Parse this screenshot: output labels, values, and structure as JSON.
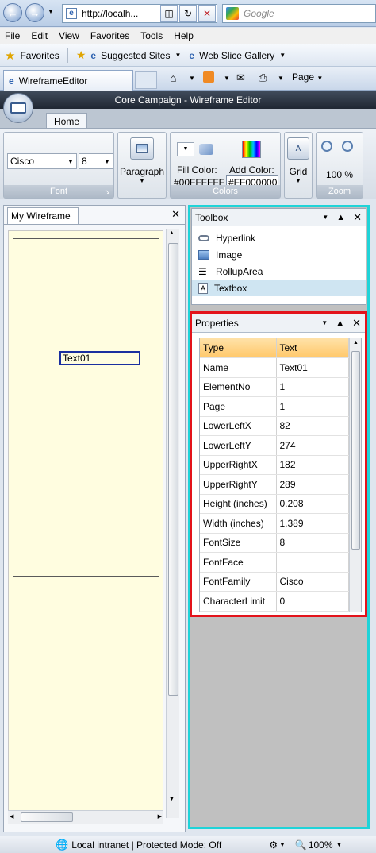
{
  "browser": {
    "url": "http://localh...",
    "search_placeholder": "Google",
    "menu": [
      "File",
      "Edit",
      "View",
      "Favorites",
      "Tools",
      "Help"
    ],
    "favorites_label": "Favorites",
    "suggested_sites": "Suggested Sites",
    "web_slice_gallery": "Web Slice Gallery",
    "tab_title": "WireframeEditor",
    "page_label": "Page"
  },
  "app": {
    "title": "Core Campaign - Wireframe Editor",
    "ribbon_tab": "Home",
    "font": {
      "family": "Cisco",
      "size": "8",
      "group_label": "Font"
    },
    "paragraph_label": "Paragraph",
    "colors": {
      "fill_label": "Fill Color:",
      "fill_value": "#00FFFFFF",
      "add_label": "Add Color:",
      "add_value": "#FF000000",
      "group_label": "Colors"
    },
    "grid_label": "Grid",
    "zoom": {
      "value": "100 %",
      "group_label": "Zoom"
    }
  },
  "wireframe": {
    "tab_label": "My Wireframe",
    "text_element": "Text01"
  },
  "toolbox": {
    "title": "Toolbox",
    "items": [
      {
        "label": "Hyperlink",
        "icon": "hyperlink-icon"
      },
      {
        "label": "Image",
        "icon": "image-icon"
      },
      {
        "label": "RollupArea",
        "icon": "list-icon"
      },
      {
        "label": "Textbox",
        "icon": "textbox-icon"
      }
    ]
  },
  "properties": {
    "title": "Properties",
    "header": [
      "Type",
      "Text"
    ],
    "rows": [
      [
        "Name",
        "Text01"
      ],
      [
        "ElementNo",
        "1"
      ],
      [
        "Page",
        "1"
      ],
      [
        "LowerLeftX",
        "82"
      ],
      [
        "LowerLeftY",
        "274"
      ],
      [
        "UpperRightX",
        "182"
      ],
      [
        "UpperRightY",
        "289"
      ],
      [
        "Height (inches)",
        "0.208"
      ],
      [
        "Width (inches)",
        "1.389"
      ],
      [
        "FontSize",
        "8"
      ],
      [
        "FontFace",
        ""
      ],
      [
        "FontFamily",
        "Cisco"
      ],
      [
        "CharacterLimit",
        "0"
      ]
    ]
  },
  "status": {
    "zone": "Local intranet | Protected Mode: Off",
    "zoom": "100%"
  },
  "colors": {
    "toolbox_highlight": "#1fd3d8",
    "properties_highlight": "#e3131b",
    "canvas_bg": "#fffde0"
  }
}
